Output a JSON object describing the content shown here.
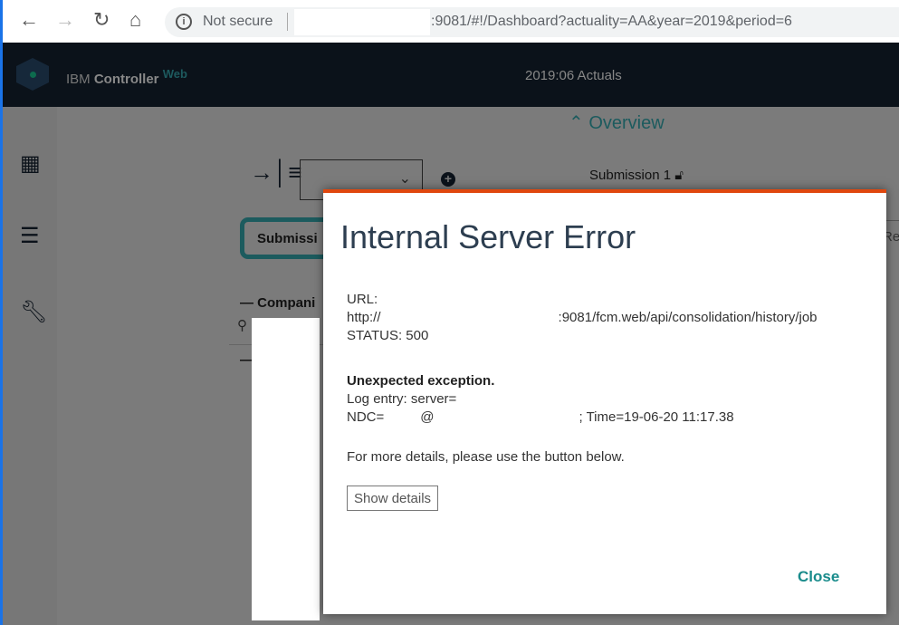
{
  "browser": {
    "security_label": "Not secure",
    "url": ":9081/#!/Dashboard?actuality=AA&year=2019&period=6"
  },
  "app": {
    "brand_prefix": "IBM",
    "brand_name": "Controller",
    "brand_suffix": "Web",
    "period_title": "2019:06 Actuals"
  },
  "background": {
    "overview_label": "Overview",
    "submission_label": "Submission 1",
    "submission_button": "Submissi",
    "companies_label": "Compani",
    "right_fragment": "Re"
  },
  "dialog": {
    "title": "Internal Server Error",
    "url_label": "URL:",
    "url_start": "http://",
    "url_end": ":9081/fcm.web/api/consolidation/history/job",
    "status": "STATUS: 500",
    "exception": "Unexpected exception.",
    "log_entry": "Log entry: server=",
    "ndc_start": "NDC=",
    "ndc_at": "@",
    "ndc_time": "; Time=19-06-20 11:17.38",
    "more_details": "For more details, please use the button below.",
    "show_details_button": "Show details",
    "close_button": "Close"
  },
  "colors": {
    "accent": "#1c5b5e",
    "error_bar": "#e0470e",
    "close_text": "#1a8c8c",
    "header_bg": "#0b121a"
  }
}
